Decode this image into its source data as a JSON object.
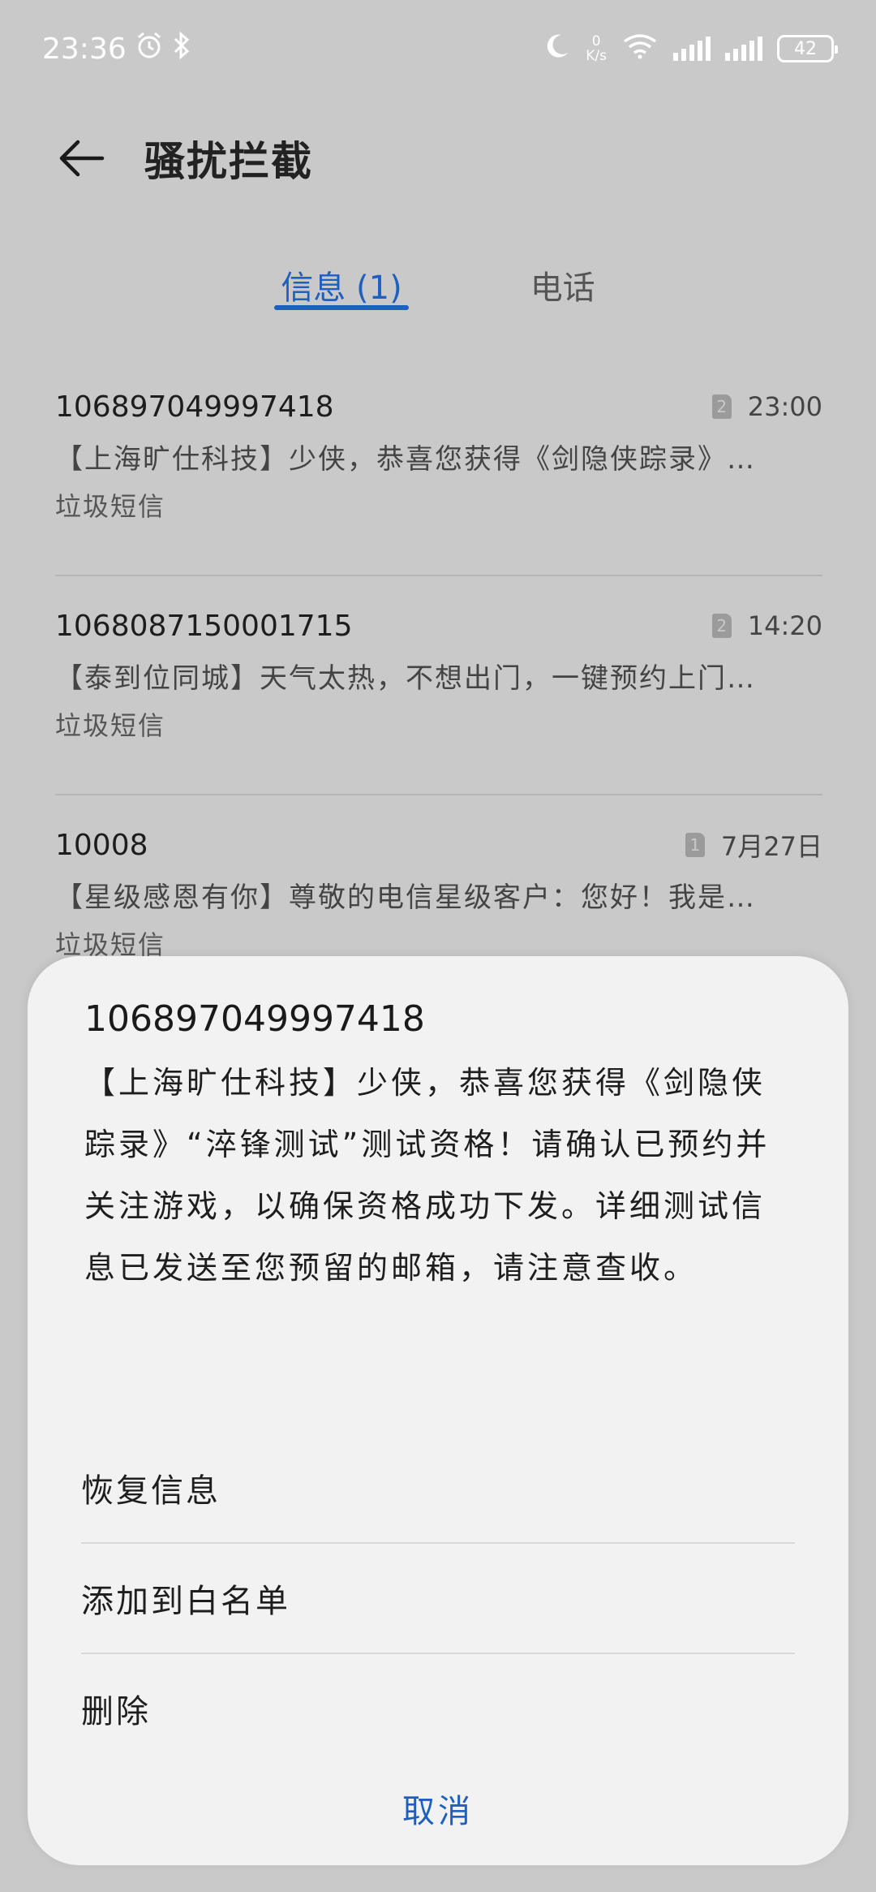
{
  "status_bar": {
    "time": "23:36",
    "net_speed_value": "0",
    "net_speed_unit": "K/s",
    "battery": "42"
  },
  "header": {
    "title": "骚扰拦截"
  },
  "tabs": [
    {
      "label": "信息 (1)",
      "active": true
    },
    {
      "label": "电话",
      "active": false
    }
  ],
  "messages": [
    {
      "number": "106897049997418",
      "sim": "2",
      "time": "23:00",
      "preview": "【上海旷仕科技】少侠，恭喜您获得《剑隐侠踪录》…",
      "tag": "垃圾短信"
    },
    {
      "number": "1068087150001715",
      "sim": "2",
      "time": "14:20",
      "preview": "【泰到位同城】天气太热，不想出门，一键预约上门…",
      "tag": "垃圾短信"
    },
    {
      "number": "10008",
      "sim": "1",
      "time": "7月27日",
      "preview": "【星级感恩有你】尊敬的电信星级客户：您好！我是…",
      "tag": "垃圾短信"
    }
  ],
  "sheet": {
    "title": "106897049997418",
    "body": "【上海旷仕科技】少侠，恭喜您获得《剑隐侠踪录》“淬锋测试”测试资格！请确认已预约并关注游戏，以确保资格成功下发。详细测试信息已发送至您预留的邮箱，请注意查收。",
    "actions": [
      "恢复信息",
      "添加到白名单",
      "删除"
    ],
    "cancel": "取消"
  },
  "colors": {
    "accent": "#1f5fbf",
    "dim_background": "#c9c9c9",
    "sheet_background": "#f2f2f2"
  }
}
